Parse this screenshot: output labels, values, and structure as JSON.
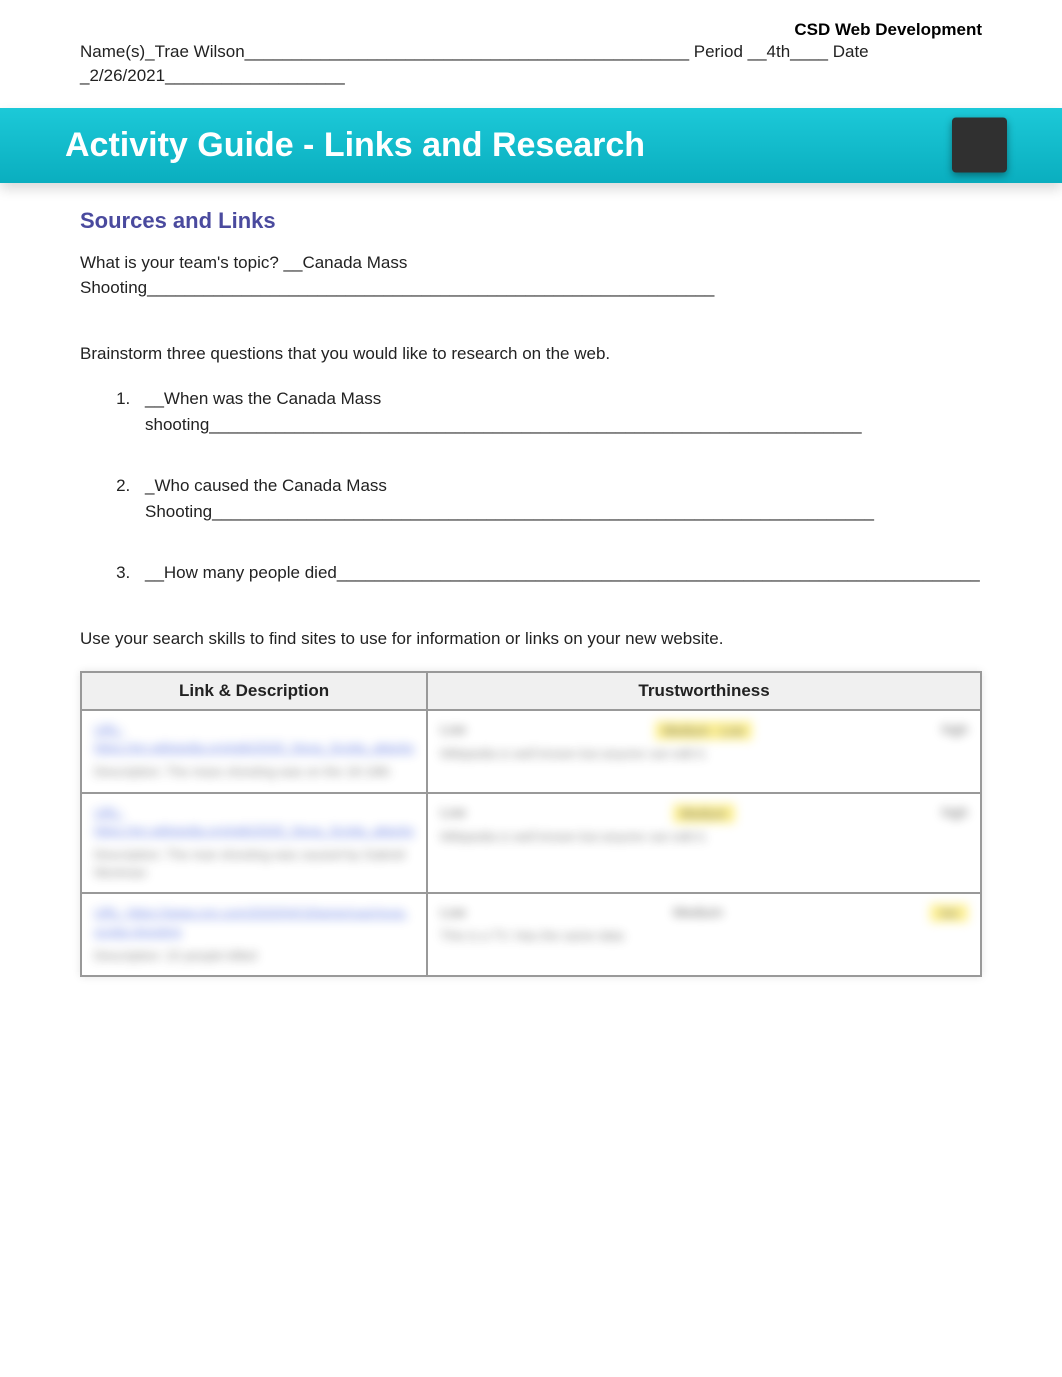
{
  "course_title": "CSD Web Development",
  "meta_line1": "Name(s)_Trae Wilson_______________________________________________ Period __4th____ Date",
  "meta_line2": "_2/26/2021___________________",
  "banner_title": "Activity Guide - Links and Research",
  "section_title": "Sources and Links",
  "topic_line": "What is your team's  topic?  __Canada Mass Shooting____________________________________________________________",
  "brainstorm_prompt": "Brainstorm three questions that you would like to research on the web.",
  "questions": [
    " __When was the Canada Mass shooting_____________________________________________________________________",
    "_Who caused the Canada Mass Shooting______________________________________________________________________",
    "__How many people died____________________________________________________________________"
  ],
  "search_prompt": "Use your search skills to find sites to use for information or links on your new website.",
  "table": {
    "headers": [
      "Link & Description",
      "Trustworthiness"
    ],
    "rows": [
      {
        "link": "URL: https://en.wikipedia.org/wiki/2020_Nova_Scotia_attacks",
        "desc": "Description: The mass shooting was on the 18-19th",
        "trust_label": "Medium - Low",
        "trust_side": "high",
        "trust_note": "Wikipedia is well known but anyone can edit it."
      },
      {
        "link": "URL: https://en.wikipedia.org/wiki/2020_Nova_Scotia_attacks",
        "desc": "Description: The man shooting was caused by Gabriel Wortman",
        "trust_label": "Medium",
        "trust_side": "high",
        "trust_note": "Wikipedia is well known but anyone can edit it."
      },
      {
        "link": "URL: https://www.cnn.com/2020/04/19/americas/nova-scotia-shooting",
        "desc": "Description: 22 people killed",
        "trust_label": "Medium",
        "trust_side": "low",
        "trust_note": "This is a TV. Has the same data"
      }
    ]
  }
}
